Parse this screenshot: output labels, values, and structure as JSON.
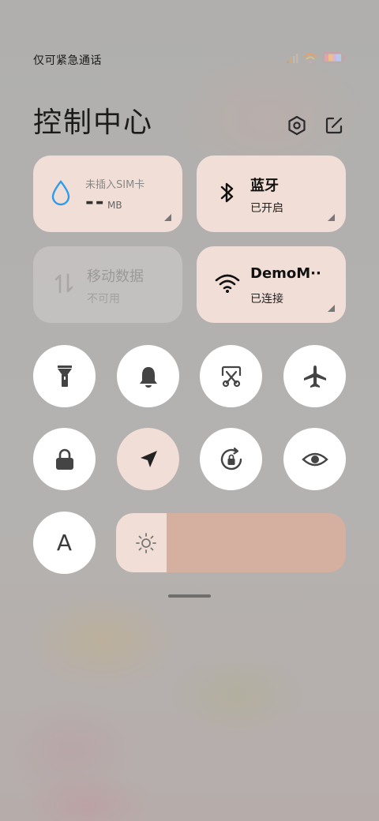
{
  "status_bar": {
    "carrier_text": "仅可紧急通话",
    "icons": [
      "signal-icon",
      "wifi-icon",
      "battery-icon"
    ]
  },
  "header": {
    "title": "控制中心",
    "settings_icon": "settings-icon",
    "edit_icon": "edit-icon"
  },
  "tiles": {
    "data_usage": {
      "line1": "未插入SIM卡",
      "value": "--",
      "unit": "MB"
    },
    "bluetooth": {
      "title": "蓝牙",
      "status": "已开启"
    },
    "mobile_data": {
      "title": "移动数据",
      "status": "不可用"
    },
    "wifi": {
      "title": "DemoM··",
      "status": "已连接"
    }
  },
  "toggles": {
    "row1": [
      "flashlight-icon",
      "bell-icon",
      "screenshot-icon",
      "airplane-icon"
    ],
    "row2": [
      "lock-icon",
      "location-icon",
      "rotation-lock-icon",
      "eye-icon"
    ],
    "font_button": "A"
  },
  "brightness": {
    "level": 0.22
  },
  "colors": {
    "tile_active": "#f1ded6",
    "tile_disabled": "#cdcac7",
    "slider_track": "#d5afa0",
    "accent_blue": "#2c9cf0"
  }
}
